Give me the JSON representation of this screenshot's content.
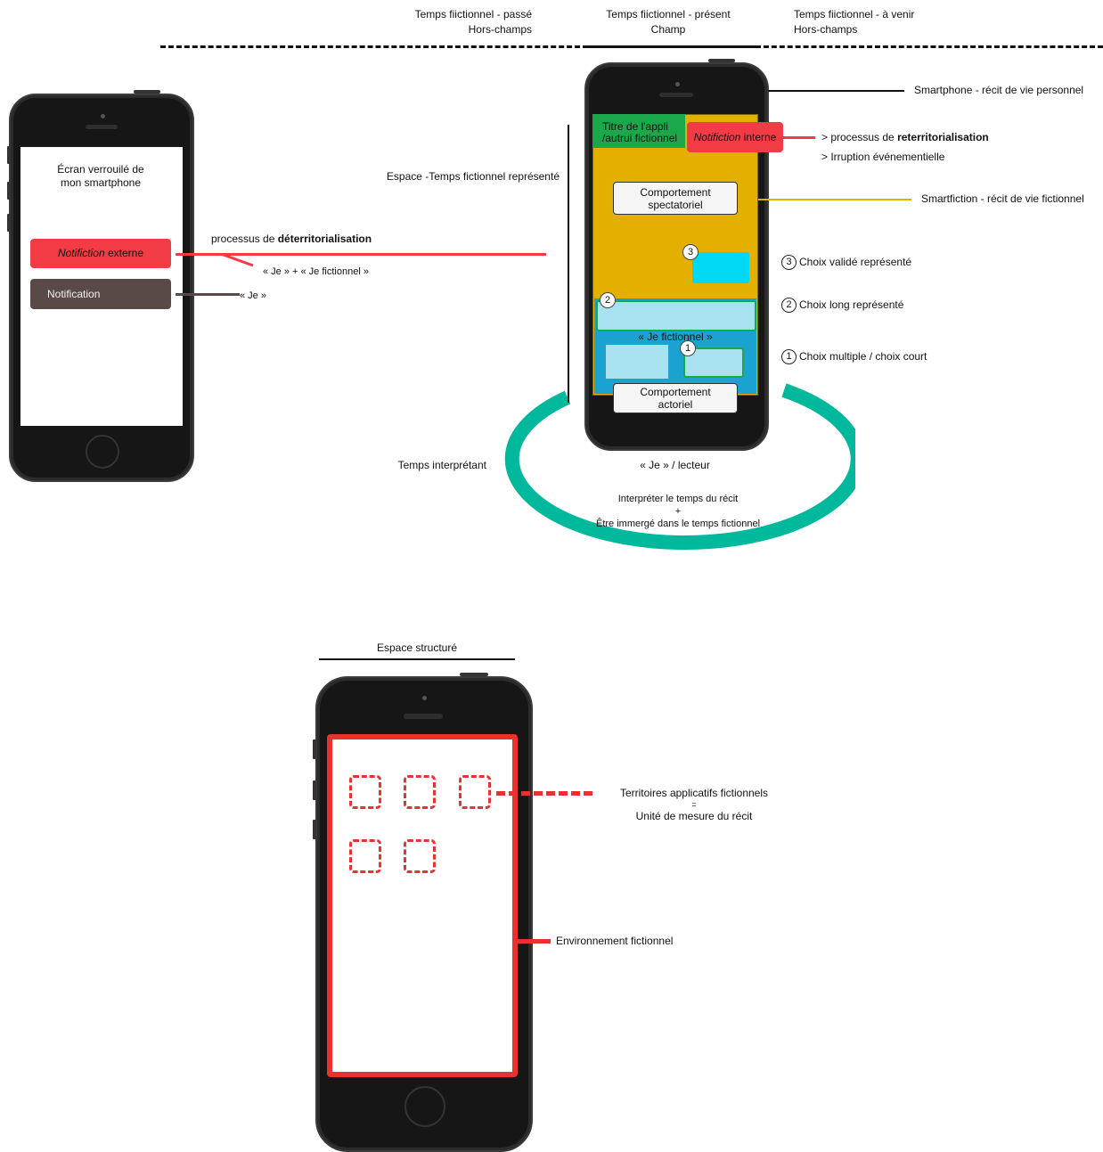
{
  "timeline": {
    "past_line1": "Temps fiictionnel - passé",
    "past_line2": "Hors-champs",
    "present_line1": "Temps fiictionnel - présent",
    "present_line2": "Champ",
    "future_line1": "Temps fiictionnel - à venir",
    "future_line2": "Hors-champs"
  },
  "left_phone": {
    "lock_line1": "Écran verrouilé de",
    "lock_line2": "mon smartphone",
    "notif_external_em": "Notifiction",
    "notif_external_rest": " externe",
    "notif_plain": "Notification"
  },
  "left_labels": {
    "deterrit_prefix": "processus de ",
    "deterrit_bold": "déterritorialisation",
    "je_plus": "« Je » + « Je fictionnel »",
    "je": "« Je »"
  },
  "main_phone": {
    "app_title_line1": "Titre de l'appli",
    "app_title_line2": "/autrui fictionnel",
    "notif_internal_em": "Notifiction",
    "notif_internal_rest": " interne",
    "spectator_line1": "Comportement",
    "spectator_line2": "spectatoriel",
    "je_fictionnel": "« Je fictionnel »",
    "actor_line1": "Comportement",
    "actor_line2": "actoriel",
    "badge1": "1",
    "badge2": "2",
    "badge3": "3"
  },
  "right_labels": {
    "smartphone": "Smartphone - récit de vie personnel",
    "reterrit_prefix": "> processus de ",
    "reterrit_bold": "reterritorialisation",
    "irruption": "> Irruption événementielle",
    "smartfiction": "Smartfiction - récit de vie fictionnel",
    "choice3_num": "3",
    "choice3": "Choix validé représenté",
    "choice2_num": "2",
    "choice2": "Choix long représenté",
    "choice1_num": "1",
    "choice1": "Choix multiple / choix court",
    "espace_temps": "Espace -Temps fictionnel représenté",
    "temps_interpretant": "Temps interprétant",
    "lecteur": "« Je » / lecteur",
    "interpreter_line1": "Interpréter le temps du récit",
    "interpreter_plus": "+",
    "interpreter_line2": "Être immergé dans le temps fictionnel"
  },
  "bottom": {
    "espace_structure": "Espace structuré",
    "territoires": "Territoires applicatifs fictionnels",
    "equals": "=",
    "unite": "Unité de mesure du récit",
    "environnement": "Environnement fictionnel"
  },
  "colors": {
    "red": "#f23b45",
    "brown": "#5a4a47",
    "green": "#1aa84a",
    "mustard": "#e3b000",
    "blue": "#1aa3d1",
    "lightblue": "#a8e2f0",
    "cyan": "#00d8f4",
    "teal": "#00b89b",
    "frame_red": "#e8322f"
  }
}
